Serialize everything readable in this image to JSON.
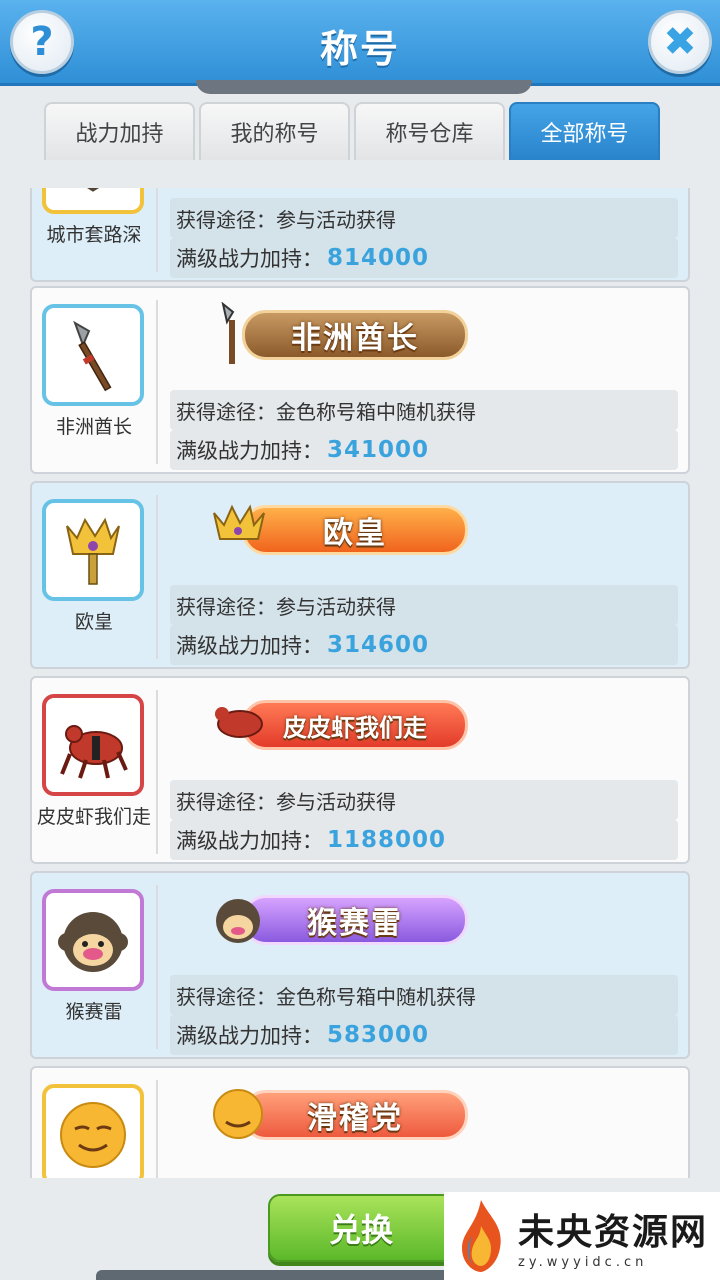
{
  "header": {
    "title": "称号"
  },
  "tabs": [
    {
      "label": "战力加持",
      "active": false
    },
    {
      "label": "我的称号",
      "active": false
    },
    {
      "label": "称号仓库",
      "active": false
    },
    {
      "label": "全部称号",
      "active": true
    }
  ],
  "labels": {
    "source_prefix": "获得途径：",
    "power_prefix": "满级战力加持："
  },
  "titles": [
    {
      "name": "城市套路深",
      "badge": "",
      "source": "参与活动获得",
      "power": "814000"
    },
    {
      "name": "非洲酋长",
      "badge": "非洲酋长",
      "source": "金色称号箱中随机获得",
      "power": "341000"
    },
    {
      "name": "欧皇",
      "badge": "欧皇",
      "source": "参与活动获得",
      "power": "314600"
    },
    {
      "name": "皮皮虾我们走",
      "badge": "皮皮虾我们走",
      "source": "参与活动获得",
      "power": "1188000"
    },
    {
      "name": "猴赛雷",
      "badge": "猴赛雷",
      "source": "金色称号箱中随机获得",
      "power": "583000"
    },
    {
      "name": "",
      "badge": "滑稽党",
      "source": "",
      "power": ""
    }
  ],
  "buttons": {
    "exchange": "兑换"
  },
  "watermark": {
    "title": "未央资源网",
    "url": "zy.wyyidc.cn"
  },
  "colors": {
    "header_blue": "#2f8fd6",
    "power_value": "#3aa3de",
    "exchange_green": "#5cb82a"
  }
}
